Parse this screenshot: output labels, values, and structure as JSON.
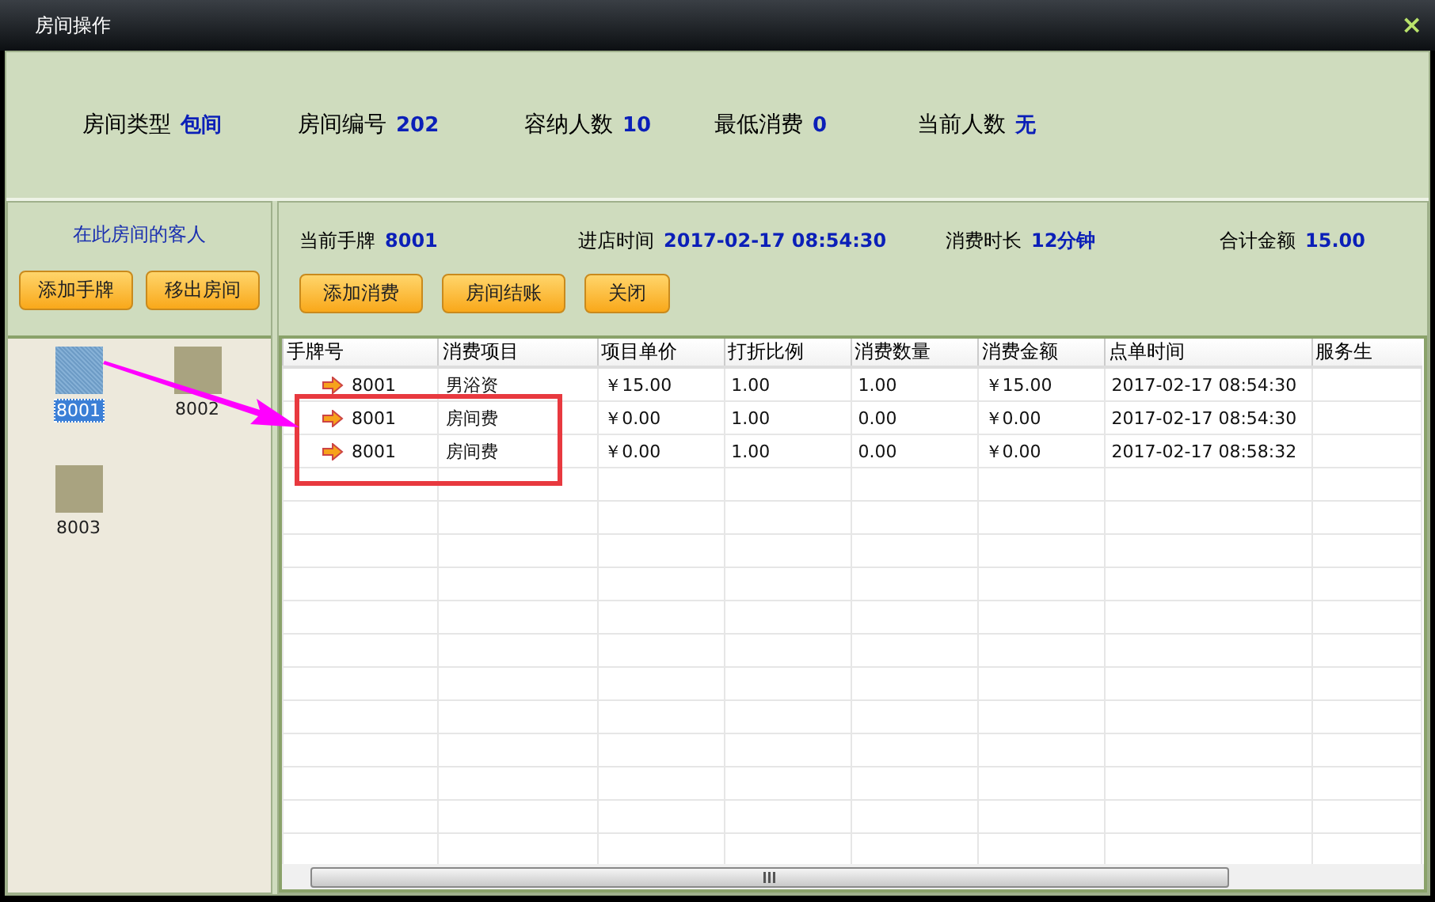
{
  "window": {
    "title": "房间操作",
    "close": "×"
  },
  "room_info": [
    {
      "label": "房间类型",
      "value": "包间"
    },
    {
      "label": "房间编号",
      "value": "202"
    },
    {
      "label": "容纳人数",
      "value": "10"
    },
    {
      "label": "最低消费",
      "value": "0"
    },
    {
      "label": "当前人数",
      "value": "无"
    }
  ],
  "guests_panel": {
    "title": "在此房间的客人",
    "buttons": [
      "添加手牌",
      "移出房间"
    ],
    "guests": [
      {
        "label": "8001",
        "selected": true
      },
      {
        "label": "8002",
        "selected": false
      },
      {
        "label": "8003",
        "selected": false
      }
    ]
  },
  "session_info": [
    {
      "label": "当前手牌",
      "value": "8001"
    },
    {
      "label": "进店时间",
      "value": "2017-02-17 08:54:30"
    },
    {
      "label": "消费时长",
      "value": "12分钟"
    },
    {
      "label": "合计金额",
      "value": "15.00"
    }
  ],
  "buttons": [
    "添加消费",
    "房间结账",
    "关闭"
  ],
  "table": {
    "columns": [
      "手牌号",
      "消费项目",
      "项目单价",
      "打折比例",
      "消费数量",
      "消费金额",
      "点单时间",
      "服务生"
    ],
    "rows": [
      [
        "8001",
        "男浴资",
        "￥15.00",
        "1.00",
        "1.00",
        "￥15.00",
        "2017-02-17 08:54:30",
        ""
      ],
      [
        "8001",
        "房间费",
        "￥0.00",
        "1.00",
        "0.00",
        "￥0.00",
        "2017-02-17 08:54:30",
        ""
      ],
      [
        "8001",
        "房间费",
        "￥0.00",
        "1.00",
        "0.00",
        "￥0.00",
        "2017-02-17 08:58:32",
        ""
      ]
    ]
  }
}
